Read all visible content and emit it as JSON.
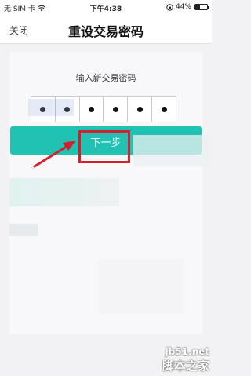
{
  "status_bar": {
    "carrier": "无 SIM 卡",
    "wifi_icon": "wifi-icon",
    "time": "下午4:38",
    "lock_icon": "orientation-lock-icon",
    "battery_percent": "44%",
    "battery_level": 0.44
  },
  "nav": {
    "close_label": "关闭",
    "title": "重设交易密码"
  },
  "form": {
    "prompt": "输入新交易密码",
    "pin_length": 6,
    "next_label": "下一步"
  },
  "colors": {
    "button": "#21c1b3",
    "highlight": "#d4202a",
    "background": "#f2f2f4"
  },
  "overlay": {
    "url": "jb51.net",
    "brand": "脚本之家"
  }
}
